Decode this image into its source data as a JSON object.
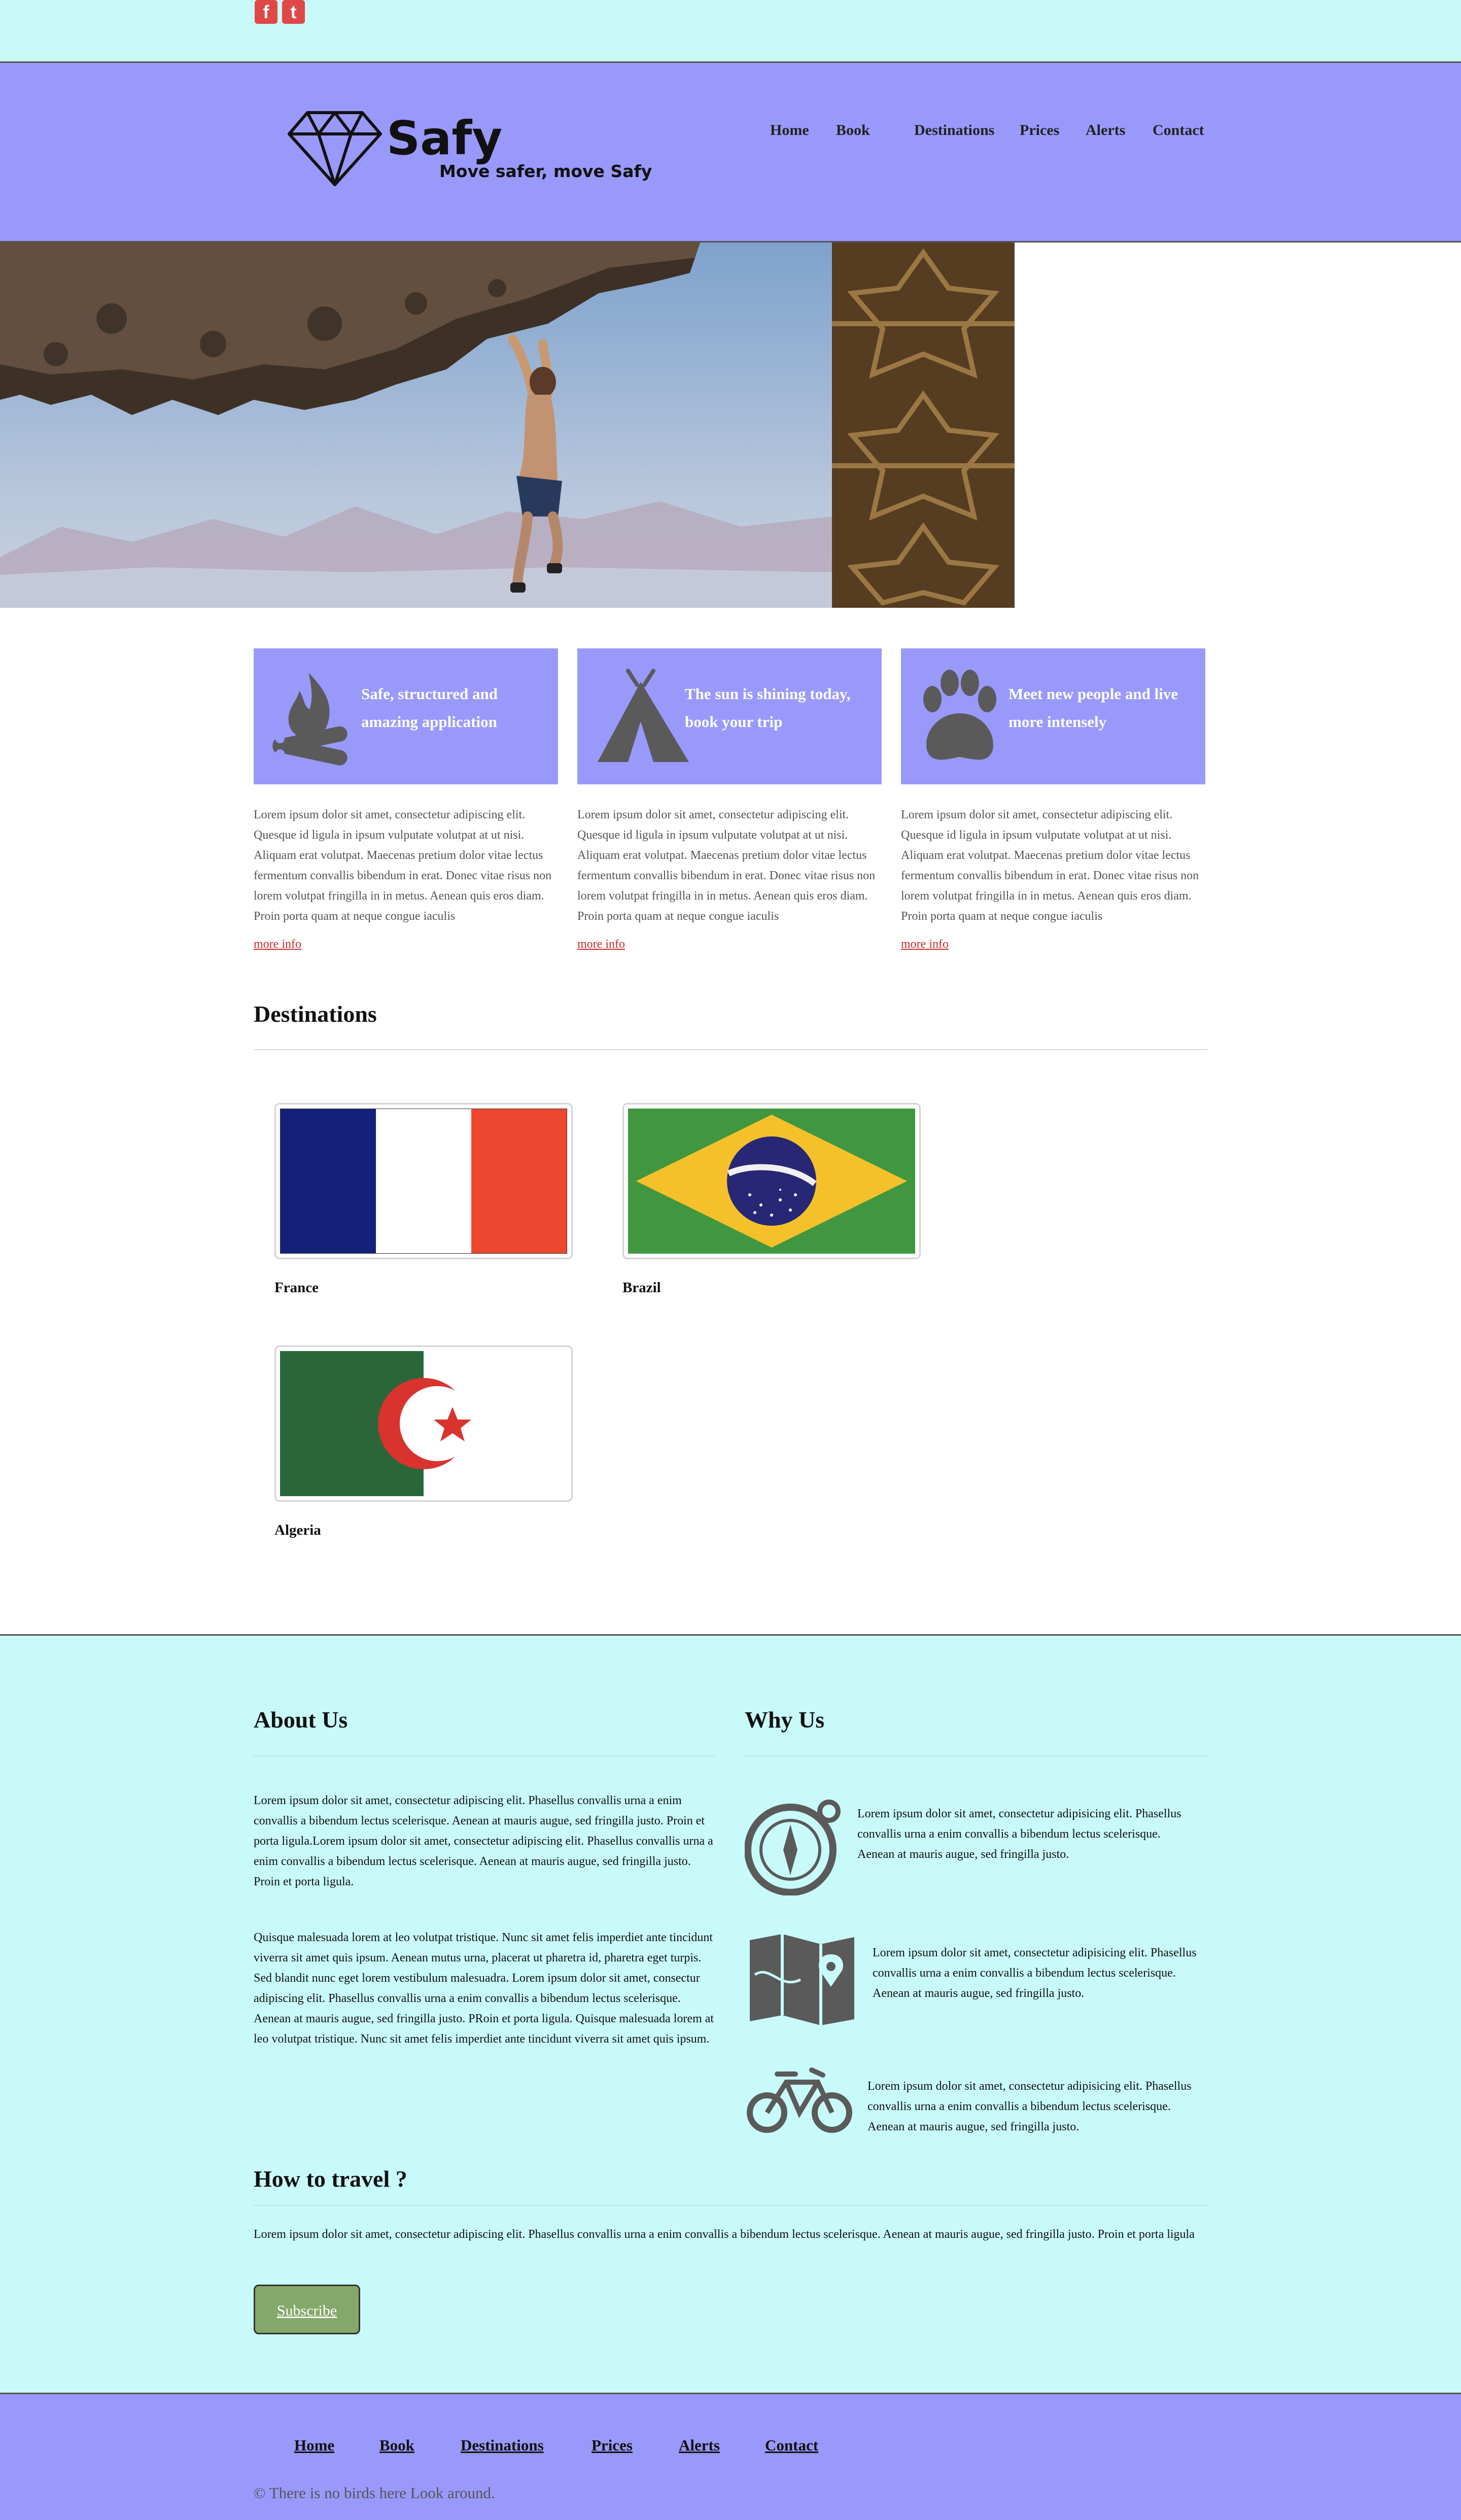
{
  "social": {
    "facebook_glyph": "f",
    "twitter_glyph": "t"
  },
  "brand": {
    "name": "Safy",
    "tagline": "Move safer, move Safy",
    "logo_icon": "diamond-icon"
  },
  "nav": [
    "Home",
    "Book",
    "Destinations",
    "Prices",
    "Alerts",
    "Contact"
  ],
  "features": [
    {
      "icon": "campfire-icon",
      "title": "Safe, structured and amazing application"
    },
    {
      "icon": "tent-icon",
      "title": "The sun is shining today, book your trip"
    },
    {
      "icon": "paw-icon",
      "title": "Meet new people and live more intensely"
    }
  ],
  "feature_text": "Lorem ipsum dolor sit amet, consectetur adipiscing elit. Quesque id ligula in ipsum vulputate volutpat at ut nisi. Aliquam erat volutpat. Maecenas pretium dolor vitae lectus fermentum convallis bibendum in erat. Donec vitae risus non lorem volutpat fringilla in in metus. Aenean quis eros diam. Proin porta quam at neque congue iaculis",
  "more_info": "more info",
  "destinations": {
    "heading": "Destinations",
    "items": [
      "France",
      "Brazil",
      "Algeria"
    ]
  },
  "about": {
    "heading": "About Us",
    "p1": "Lorem ipsum dolor sit amet, consectetur adipiscing elit. Phasellus convallis urna a enim convallis a bibendum lectus scelerisque. Aenean at mauris augue, sed fringilla justo. Proin et porta ligula.Lorem ipsum dolor sit amet, consectetur adipiscing elit. Phasellus convallis urna a enim convallis a bibendum lectus scelerisque. Aenean at mauris augue, sed fringilla justo. Proin et porta ligula.",
    "p2": "Quisque malesuada lorem at leo volutpat tristique. Nunc sit amet felis imperdiet ante tincidunt viverra sit amet quis ipsum. Aenean mutus urna, placerat ut pharetra id, pharetra eget turpis. Sed blandit nunc eget lorem vestibulum malesuadra. Lorem ipsum dolor sit amet, consectur adipiscing elit. Phasellus convallis urna a enim convallis a bibendum lectus scelerisque. Aenean at mauris augue, sed fringilla justo. PRoin et porta ligula. Quisque malesuada lorem at leo volutpat tristique. Nunc sit amet felis imperdiet ante tincidunt viverra sit amet quis ipsum."
  },
  "why": {
    "heading": "Why Us",
    "items": [
      {
        "icon": "compass-icon",
        "text": "Lorem ipsum dolor sit amet, consectetur adipisicing elit. Phasellus convallis urna a enim convallis a bibendum lectus scelerisque. Aenean at mauris augue, sed fringilla justo."
      },
      {
        "icon": "map-icon",
        "text": "Lorem ipsum dolor sit amet, consectetur adipisicing elit. Phasellus convallis urna a enim convallis a bibendum lectus scelerisque. Aenean at mauris augue, sed fringilla justo."
      },
      {
        "icon": "bicycle-icon",
        "text": "Lorem ipsum dolor sit amet, consectetur adipisicing elit. Phasellus convallis urna a enim convallis a bibendum lectus scelerisque. Aenean at mauris augue, sed fringilla justo."
      }
    ]
  },
  "travel": {
    "heading": "How to travel ?",
    "text": "Lorem ipsum dolor sit amet, consectetur adipiscing elit. Phasellus convallis urna a enim convallis a bibendum lectus scelerisque. Aenean at mauris augue, sed fringilla justo. Proin et porta ligula",
    "button": "Subscribe"
  },
  "footer": {
    "nav": [
      "Home",
      "Book",
      "Destinations",
      "Prices",
      "Alerts",
      "Contact"
    ],
    "copyright": "© There is no birds here Look around."
  },
  "colors": {
    "band": "#c8fafa",
    "header": "#9999fc",
    "link": "#c62a2a",
    "button": "#84a86a"
  }
}
